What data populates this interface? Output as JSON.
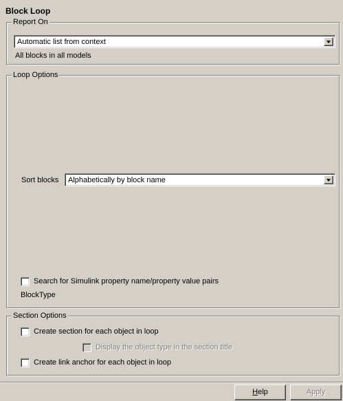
{
  "title": "Block Loop",
  "report_on": {
    "legend": "Report On",
    "combo_value": "Automatic list from context",
    "description": "All blocks in all models"
  },
  "loop_options": {
    "legend": "Loop Options",
    "sort_label": "Sort blocks",
    "sort_value": "Alphabetically by block name",
    "search_label": "Search for Simulink property name/property value pairs",
    "block_type_label": "BlockType"
  },
  "section_options": {
    "legend": "Section Options",
    "create_section_label": "Create section for each object in loop",
    "display_type_label": "Display the object type in the section title",
    "create_link_label": "Create link anchor for each object in loop"
  },
  "buttons": {
    "help_mnemonic": "H",
    "help_rest": "elp",
    "apply": "Apply"
  }
}
